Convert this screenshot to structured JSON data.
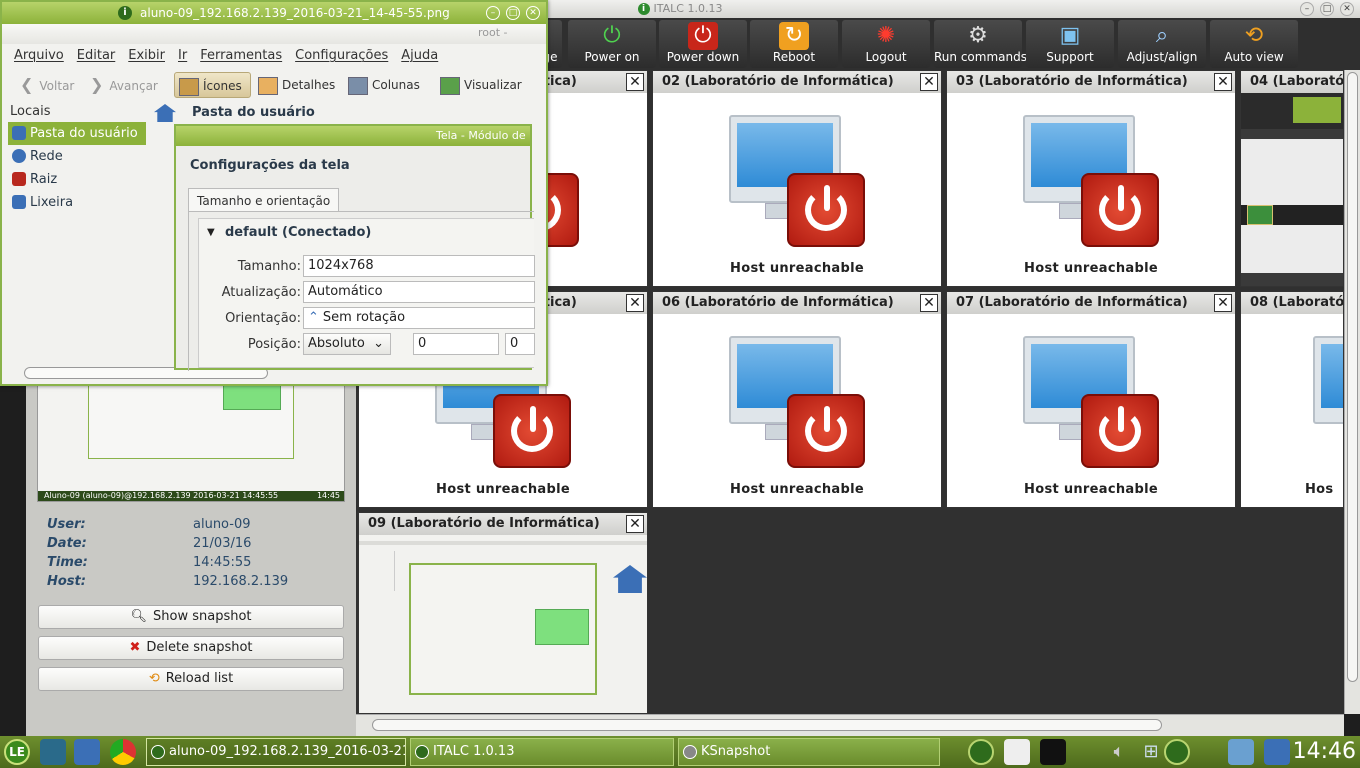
{
  "italc": {
    "title": "ITALC 1.0.13",
    "toolbar": [
      {
        "label": "ge",
        "icon": "image-icon"
      },
      {
        "label": "Power on",
        "icon": "power-on-icon"
      },
      {
        "label": "Power down",
        "icon": "power-down-icon"
      },
      {
        "label": "Reboot",
        "icon": "reboot-icon"
      },
      {
        "label": "Logout",
        "icon": "logout-icon"
      },
      {
        "label": "Run commands",
        "icon": "gear-icon"
      },
      {
        "label": "Support",
        "icon": "support-icon"
      },
      {
        "label": "Adjust/align",
        "icon": "magnifier-icon"
      },
      {
        "label": "Auto view",
        "icon": "auto-view-icon"
      }
    ],
    "snapshot": {
      "thumb_caption": "Aluno-09 (aluno-09)@192.168.2.139 2016-03-21 14:45:55",
      "thumb_time": "14:45",
      "user_label": "User:",
      "user": "aluno-09",
      "date_label": "Date:",
      "date": "21/03/16",
      "time_label": "Time:",
      "time": "14:45:55",
      "host_label": "Host:",
      "host": "192.168.2.139",
      "show_label": "Show snapshot",
      "delete_label": "Delete snapshot",
      "reload_label": "Reload list"
    },
    "tiles": [
      {
        "title": "ática)",
        "status": "able"
      },
      {
        "title": "02 (Laboratório de Informática)",
        "status": "Host unreachable"
      },
      {
        "title": "03 (Laboratório de Informática)",
        "status": "Host unreachable"
      },
      {
        "title": "04 (Laborató",
        "status": ""
      },
      {
        "title": "ática)",
        "status": "Host unreachable"
      },
      {
        "title": "06 (Laboratório de Informática)",
        "status": "Host unreachable"
      },
      {
        "title": "07 (Laboratório de Informática)",
        "status": "Host unreachable"
      },
      {
        "title": "08 (Laborató",
        "status": "Hos"
      },
      {
        "title": "09 (Laboratório de Informática)",
        "status": ""
      }
    ]
  },
  "filemanager": {
    "title": "aluno-09_192.168.2.139_2016-03-21_14-45-55.png",
    "user": "root - ",
    "menu": [
      "Arquivo",
      "Editar",
      "Exibir",
      "Ir",
      "Ferramentas",
      "Configurações",
      "Ajuda"
    ],
    "toolbar": {
      "back": "Voltar",
      "forward": "Avançar",
      "icons": "Ícones",
      "details": "Detalhes",
      "columns": "Colunas",
      "preview": "Visualizar"
    },
    "places_header": "Locais",
    "places": [
      "Pasta do usuário",
      "Rede",
      "Raiz",
      "Lixeira"
    ],
    "path": "Pasta do usuário"
  },
  "dialog": {
    "title": "Tela - Módulo de",
    "heading": "Configurações da tela",
    "tab": "Tamanho e orientação",
    "output": "default (Conectado)",
    "size_label": "Tamanho:",
    "size_value": "1024x768",
    "refresh_label": "Atualização:",
    "refresh_value": "Automático",
    "orientation_label": "Orientação:",
    "orientation_value": "Sem rotação",
    "position_label": "Posição:",
    "position_value": "Absoluto",
    "pos_x": "0",
    "pos_y": "0"
  },
  "taskbar": {
    "tasks": [
      "aluno-09_192.168.2.139_2016-03-21",
      "ITALC 1.0.13",
      "KSnapshot"
    ],
    "clock": "14:46",
    "colors": {
      "bar": "#5a7a22",
      "accent": "#8cb23a"
    }
  }
}
